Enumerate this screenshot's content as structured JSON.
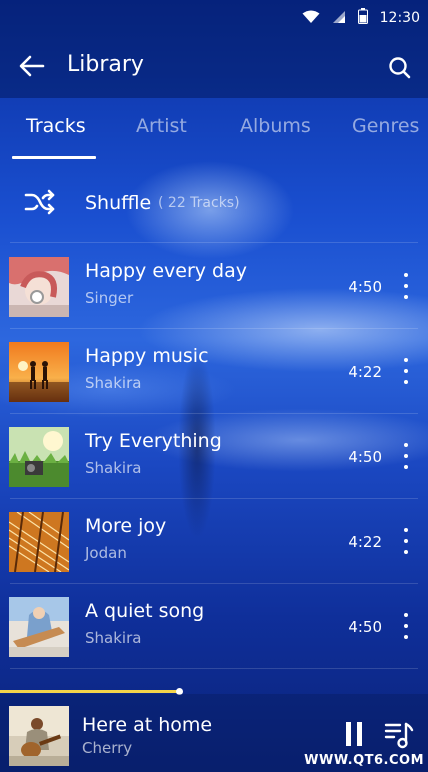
{
  "status_bar": {
    "time": "12:30"
  },
  "app_bar": {
    "title": "Library"
  },
  "tabs": [
    {
      "label": "Tracks",
      "active": true
    },
    {
      "label": "Artist",
      "active": false
    },
    {
      "label": "Albums",
      "active": false
    },
    {
      "label": "Genres",
      "active": false
    }
  ],
  "shuffle": {
    "label": "Shuffle",
    "count": "( 22 Tracks)"
  },
  "tracks": [
    {
      "title": "Happy every day",
      "artist": "Singer",
      "duration": "4:50"
    },
    {
      "title": "Happy music",
      "artist": "Shakira",
      "duration": "4:22"
    },
    {
      "title": "Try Everything",
      "artist": "Shakira",
      "duration": "4:50"
    },
    {
      "title": "More joy",
      "artist": "Jodan",
      "duration": "4:22"
    },
    {
      "title": "A quiet song",
      "artist": "Shakira",
      "duration": "4:50"
    }
  ],
  "now_playing": {
    "title": "Here at home",
    "artist": "Cherry",
    "progress_fraction": 0.42,
    "progress_color": "#f4d44a"
  },
  "watermark": "WWW.QT6.COM"
}
